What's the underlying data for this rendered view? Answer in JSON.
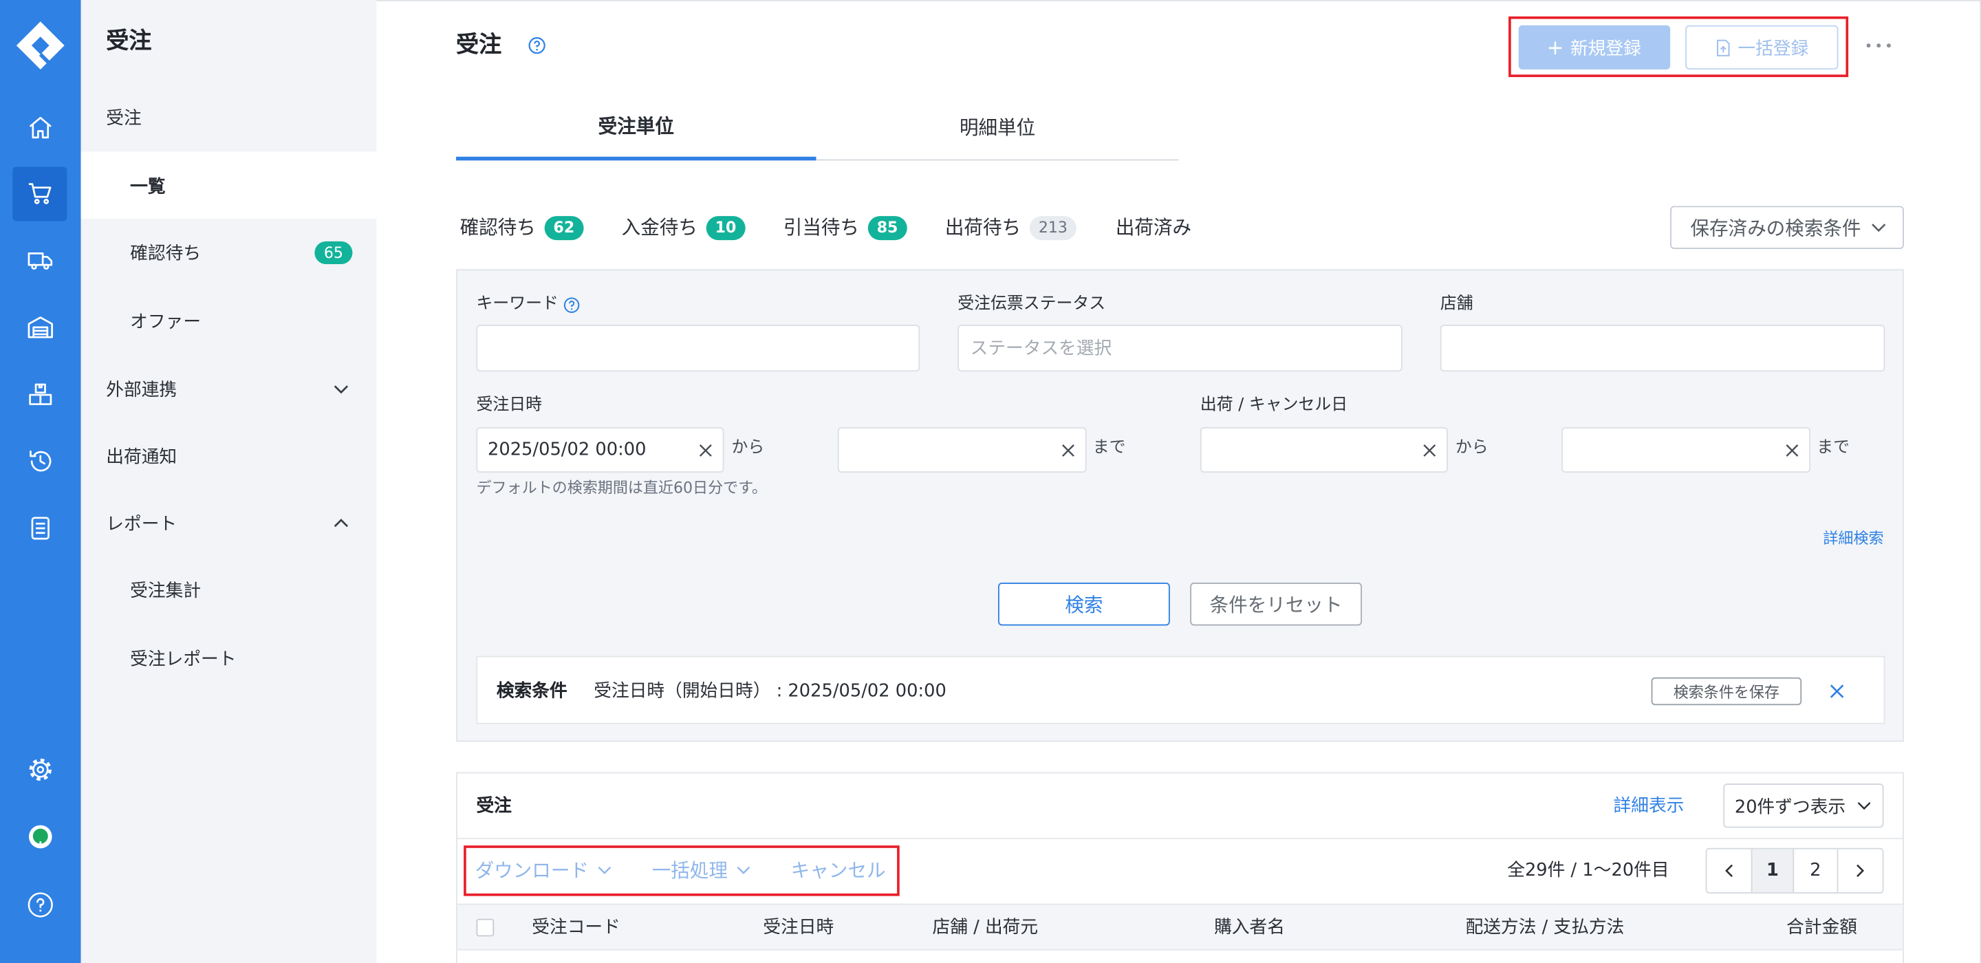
{
  "colors": {
    "rail": "#2f81e4",
    "rail_active": "#1d6bd0",
    "accent": "#2f81e4",
    "badge": "#12b39a",
    "highlight": "#e8202a",
    "panel": "#f3f5f8"
  },
  "rail": {
    "logo": "logo-icon",
    "items": [
      {
        "icon": "home-icon"
      },
      {
        "icon": "cart-icon",
        "active": true
      },
      {
        "icon": "truck-icon"
      },
      {
        "icon": "warehouse-icon"
      },
      {
        "icon": "boxes-icon"
      },
      {
        "icon": "history-icon"
      },
      {
        "icon": "list-icon"
      }
    ],
    "bottom": [
      {
        "icon": "gear-icon"
      },
      {
        "icon": "status-icon"
      },
      {
        "icon": "help-icon"
      }
    ]
  },
  "sidebar": {
    "title": "受注",
    "items": [
      {
        "label": "受注"
      },
      {
        "label": "一覧",
        "active": true
      },
      {
        "label": "確認待ち",
        "badge": "65"
      },
      {
        "label": "オファー"
      },
      {
        "label": "外部連携",
        "expanded": false
      },
      {
        "label": "出荷通知"
      },
      {
        "label": "レポート",
        "expanded": true
      },
      {
        "label": "受注集計"
      },
      {
        "label": "受注レポート"
      }
    ]
  },
  "header": {
    "title": "受注",
    "new_button": "新規登録",
    "bulk_button": "一括登録"
  },
  "tabs": [
    {
      "label": "受注単位",
      "active": true
    },
    {
      "label": "明細単位"
    }
  ],
  "status_filters": [
    {
      "label": "確認待ち",
      "count": "62"
    },
    {
      "label": "入金待ち",
      "count": "10"
    },
    {
      "label": "引当待ち",
      "count": "85"
    },
    {
      "label": "出荷待ち",
      "count": "213"
    },
    {
      "label": "出荷済み"
    }
  ],
  "saved_search": "保存済みの検索条件",
  "search": {
    "keyword_label": "キーワード",
    "keyword_value": "",
    "status_label": "受注伝票ステータス",
    "status_placeholder": "ステータスを選択",
    "store_label": "店舗",
    "store_value": "",
    "order_date_label": "受注日時",
    "order_date_from": "2025/05/02 00:00",
    "order_date_to": "",
    "ship_date_label": "出荷 / キャンセル日",
    "ship_date_from": "",
    "ship_date_to": "",
    "from_word": "から",
    "to_word": "まで",
    "hint": "デフォルトの検索期間は直近60日分です。",
    "advanced_link": "詳細検索",
    "search_button": "検索",
    "reset_button": "条件をリセット"
  },
  "conditions": {
    "label": "検索条件",
    "text": "受注日時（開始日時） : 2025/05/02 00:00",
    "save_button": "検索条件を保存"
  },
  "results": {
    "title": "受注",
    "detail_link": "詳細表示",
    "page_size": "20件ずつ表示",
    "actions": {
      "download": "ダウンロード",
      "bulk": "一括処理",
      "cancel": "キャンセル"
    },
    "summary": "全29件 / 1〜20件目",
    "pages": [
      "1",
      "2"
    ],
    "current_page": "1",
    "columns": [
      "受注コード",
      "受注日時",
      "店舗 / 出荷元",
      "購入者名",
      "配送方法 / 支払方法",
      "合計金額"
    ]
  }
}
